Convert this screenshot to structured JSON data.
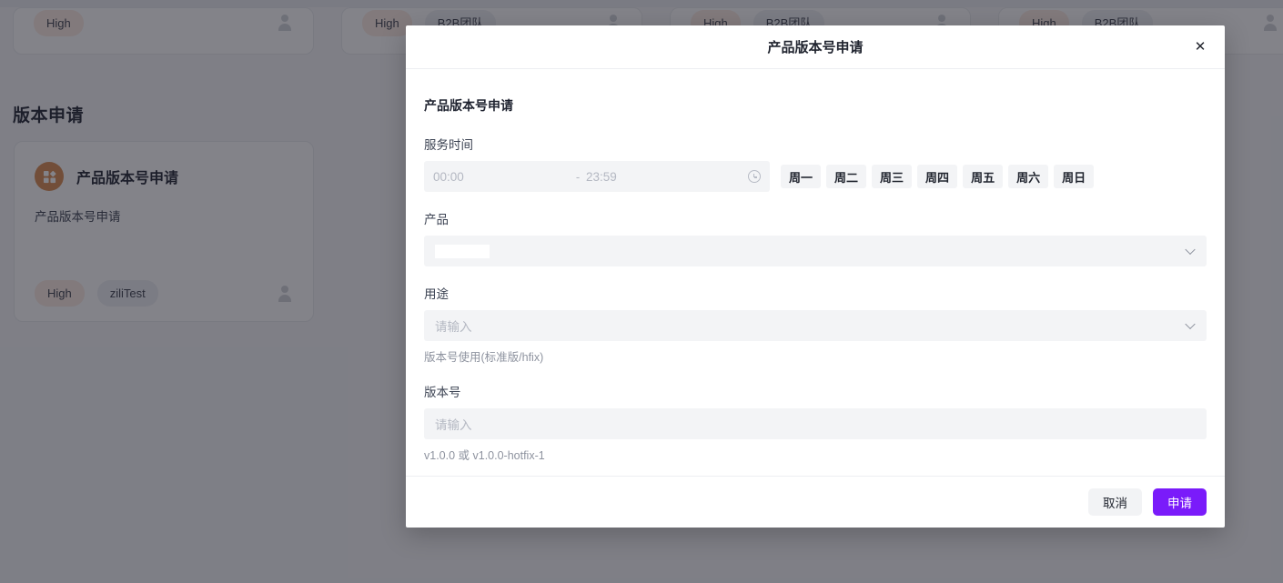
{
  "background": {
    "top_cards": [
      {
        "priority": "High",
        "tag": "",
        "tag_redacted": true
      },
      {
        "priority": "High",
        "tag": "B2B团队",
        "tag_redacted": false
      },
      {
        "priority": "High",
        "tag": "B2B团队",
        "tag_redacted": false
      },
      {
        "priority": "High",
        "tag": "B2B团队",
        "tag_redacted": false
      }
    ],
    "section_title": "版本申请",
    "version_card": {
      "icon": "grid-app-icon",
      "icon_color": "#d98a4e",
      "title": "产品版本号申请",
      "description": "产品版本号申请",
      "priority": "High",
      "team": "ziliTest",
      "avatar": "user-avatar-icon"
    }
  },
  "modal": {
    "title": "产品版本号申请",
    "close_label": "✕",
    "form_heading": "产品版本号申请",
    "fields": {
      "service_time": {
        "label": "服务时间",
        "start_placeholder": "00:00",
        "separator": "-",
        "end_placeholder": "23:59",
        "icon": "clock-icon",
        "weekdays": [
          "周一",
          "周二",
          "周三",
          "周四",
          "周五",
          "周六",
          "周日"
        ]
      },
      "product": {
        "label": "产品",
        "placeholder": "",
        "value_redacted": true,
        "icon": "chevron-down-icon"
      },
      "usage": {
        "label": "用途",
        "placeholder": "请输入",
        "help": "版本号使用(标准版/hfix)",
        "icon": "chevron-down-icon"
      },
      "version": {
        "label": "版本号",
        "placeholder": "请输入",
        "help": "v1.0.0 或 v1.0.0-hotfix-1"
      }
    },
    "footer": {
      "cancel_label": "取消",
      "submit_label": "申请"
    }
  },
  "colors": {
    "primary": "#7a1bfa",
    "overlay": "#1d1e28",
    "icon_orange": "#d98a4e",
    "field_bg": "#f3f4f6"
  }
}
